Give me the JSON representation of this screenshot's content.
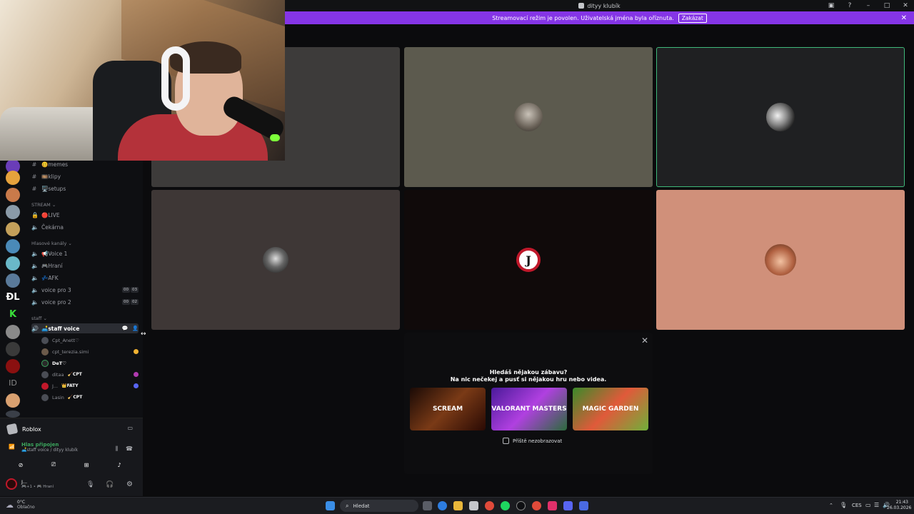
{
  "window": {
    "title": "dityy klubík"
  },
  "banner": {
    "message": "Streamovací režim je povolen. Uživatelská jména byla oříznuta.",
    "disable_label": "Zakázat"
  },
  "channels": {
    "text": [
      {
        "label": "🥴memes"
      },
      {
        "label": "🎞️klipy"
      },
      {
        "label": "🖥️setups"
      }
    ],
    "categories": {
      "stream": "STREAM",
      "voice": "Hlasové kanály",
      "staff": "staff"
    },
    "stream_channels": [
      {
        "label": "🔴LIVE"
      },
      {
        "label": "Čekárna"
      }
    ],
    "voice_channels": [
      {
        "label": "📢Voice 1"
      },
      {
        "label": "🎮Hraní"
      },
      {
        "label": "💤AFK"
      },
      {
        "label": "voice pro 3",
        "badges": [
          "00",
          "03"
        ]
      },
      {
        "label": "voice pro 2",
        "badges": [
          "00",
          "02"
        ]
      }
    ],
    "staff_voice": {
      "label": "🛋️staff voice"
    },
    "members": [
      {
        "name": "Cpt_Anett♡",
        "tag": ""
      },
      {
        "name": "cpt_terezia.simi",
        "tag": ""
      },
      {
        "name": "DeT♡",
        "tag": ""
      },
      {
        "name": "ditaa",
        "tag": "🧹CPT"
      },
      {
        "name": "J...",
        "tag": "👑FATY"
      },
      {
        "name": "Lasin",
        "tag": "🧹CPT"
      }
    ]
  },
  "activity": {
    "game": "Roblox",
    "voice_status": "Hlas připojen",
    "voice_channel_path": "🛋️staff voice / dityy klubík",
    "user_name": "J...",
    "user_status": "🎮+1 • 🎮 Hraní"
  },
  "promo": {
    "heading_line1": "Hledáš nějakou zábavu?",
    "heading_line2": "Na nic nečekej a pusť si nějakou hru nebo videa.",
    "cards": [
      {
        "label": "SCREAM",
        "color": "#5a2a12"
      },
      {
        "label": "VALORANT MASTERS",
        "color": "#7b2fd0"
      },
      {
        "label": "MAGIC GARDEN",
        "color": "#6fb03a"
      }
    ],
    "checkbox_label": "Příště nezobrazovat"
  },
  "tiles": [
    {
      "color": "#3d3b3a"
    },
    {
      "color": "#5c5a4e"
    },
    {
      "color": "#1f2022",
      "highlight": "#3fb97a"
    },
    {
      "color": "#3e3736"
    },
    {
      "color": "#100a0a"
    },
    {
      "color": "#d0907a"
    }
  ],
  "taskbar": {
    "weather_temp": "0°C",
    "weather_desc": "Oblačno",
    "search_placeholder": "Hledat",
    "language": "CES",
    "time": "21:43",
    "date": "26.03.2026"
  }
}
